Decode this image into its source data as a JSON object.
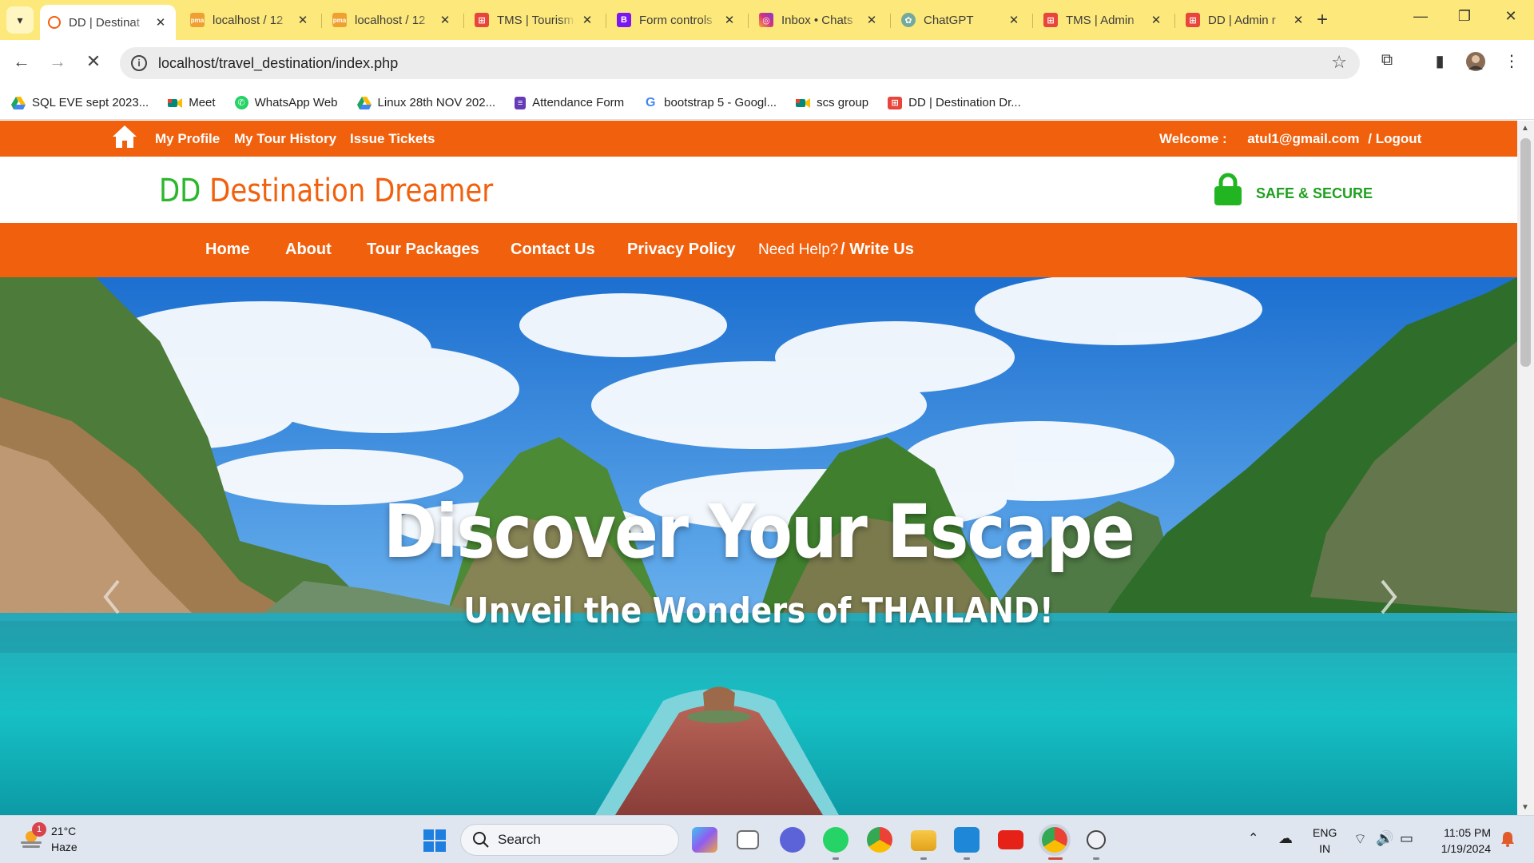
{
  "browser": {
    "tabs": [
      {
        "title": "DD | Destinat",
        "active": true,
        "favicon": "dd-favicon-icon",
        "color": "#f1600d"
      },
      {
        "title": "localhost / 12",
        "favicon": "phpmyadmin-icon",
        "color": "#f0a030"
      },
      {
        "title": "localhost / 12",
        "favicon": "phpmyadmin-icon",
        "color": "#f0a030"
      },
      {
        "title": "TMS | Tourism",
        "favicon": "tms-icon",
        "color": "#e8453c"
      },
      {
        "title": "Form controls",
        "favicon": "bootstrap-icon",
        "color": "#7b18f2"
      },
      {
        "title": "Inbox • Chats",
        "favicon": "instagram-icon",
        "color": "#d62f82"
      },
      {
        "title": "ChatGPT",
        "favicon": "chatgpt-icon",
        "color": "#74aa9c"
      },
      {
        "title": "TMS | Admin",
        "favicon": "tms-icon",
        "color": "#e8453c"
      },
      {
        "title": "DD | Admin r",
        "favicon": "dd-admin-icon",
        "color": "#e8453c"
      }
    ],
    "url": "localhost/travel_destination/index.php",
    "bookmarks": [
      {
        "label": "SQL EVE sept 2023...",
        "icon": "google-drive-icon",
        "color": "#1fa463"
      },
      {
        "label": "Meet",
        "icon": "google-meet-icon",
        "color": "#00897b"
      },
      {
        "label": "WhatsApp Web",
        "icon": "whatsapp-icon",
        "color": "#25d366"
      },
      {
        "label": "Linux 28th NOV 202...",
        "icon": "google-drive-icon",
        "color": "#1fa463"
      },
      {
        "label": "Attendance Form",
        "icon": "google-forms-icon",
        "color": "#673ab7"
      },
      {
        "label": "bootstrap 5 - Googl...",
        "icon": "google-icon",
        "color": "#4285f4"
      },
      {
        "label": "scs group",
        "icon": "google-meet-icon",
        "color": "#00897b"
      },
      {
        "label": "DD | Destination Dr...",
        "icon": "dd-favicon-icon",
        "color": "#f1600d"
      }
    ]
  },
  "site": {
    "topbar": {
      "links": [
        "My Profile",
        "My Tour History",
        "Issue Tickets"
      ],
      "welcome_label": "Welcome :",
      "user_email": "atul1@gmail.com",
      "logout_label": "/ Logout"
    },
    "logo": {
      "prefix": "DD",
      "name": "Destination Dreamer"
    },
    "secure_label": "SAFE & SECURE",
    "nav": [
      "Home",
      "About",
      "Tour Packages",
      "Contact Us",
      "Privacy Policy"
    ],
    "help": {
      "prefix": "Need Help?",
      "link": "/ Write Us"
    },
    "hero": {
      "title": "Discover Your Escape",
      "subtitle": "Unveil the Wonders of THAILAND!"
    },
    "colors": {
      "brand_orange": "#f1600d",
      "brand_green": "#2cb62c"
    }
  },
  "taskbar": {
    "weather": {
      "temp": "21°C",
      "desc": "Haze",
      "badge": "1"
    },
    "search_placeholder": "Search",
    "apps": [
      "copilot-icon",
      "task-view-icon",
      "teams-icon",
      "whatsapp-icon",
      "chrome-icon",
      "file-explorer-icon",
      "vscode-icon",
      "youtube-icon",
      "chrome-profile-icon",
      "snipping-tool-icon"
    ],
    "lang": {
      "line1": "ENG",
      "line2": "IN"
    },
    "time": "11:05 PM",
    "date": "1/19/2024"
  }
}
